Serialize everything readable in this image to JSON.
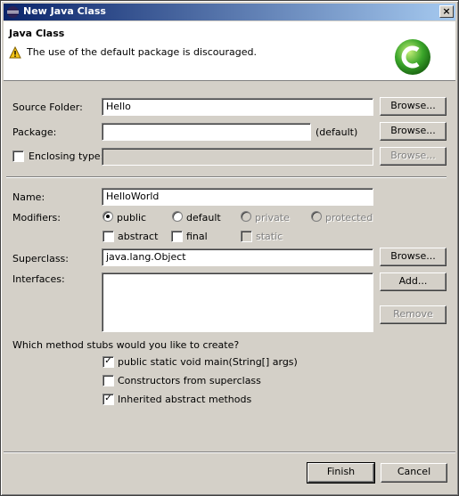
{
  "window": {
    "title": "New Java Class",
    "close_glyph": "×"
  },
  "header": {
    "title": "Java Class",
    "message": "The use of the default package is discouraged.",
    "message_icon": "warning-icon",
    "wizard_icon": "new-class-wizard-icon"
  },
  "form": {
    "source_folder": {
      "label": "Source Folder:",
      "value": "Hello",
      "browse": "Browse..."
    },
    "package": {
      "label": "Package:",
      "value": "",
      "suffix": "(default)",
      "browse": "Browse..."
    },
    "enclosing_type": {
      "label": "Enclosing type:",
      "checked": false,
      "value": "",
      "browse": "Browse..."
    },
    "name": {
      "label": "Name:",
      "value": "HelloWorld"
    },
    "modifiers": {
      "label": "Modifiers:",
      "access": [
        {
          "label": "public",
          "selected": true,
          "enabled": true
        },
        {
          "label": "default",
          "selected": false,
          "enabled": true
        },
        {
          "label": "private",
          "selected": false,
          "enabled": false
        },
        {
          "label": "protected",
          "selected": false,
          "enabled": false
        }
      ],
      "flags": [
        {
          "label": "abstract",
          "checked": false,
          "enabled": true
        },
        {
          "label": "final",
          "checked": false,
          "enabled": true
        },
        {
          "label": "static",
          "checked": false,
          "enabled": false
        }
      ]
    },
    "superclass": {
      "label": "Superclass:",
      "value": "java.lang.Object",
      "browse": "Browse..."
    },
    "interfaces": {
      "label": "Interfaces:",
      "add": "Add...",
      "remove": "Remove"
    },
    "stubs": {
      "question": "Which method stubs would you like to create?",
      "options": [
        {
          "label": "public static void main(String[] args)",
          "checked": true
        },
        {
          "label": "Constructors from superclass",
          "checked": false
        },
        {
          "label": "Inherited abstract methods",
          "checked": true
        }
      ]
    }
  },
  "footer": {
    "finish": "Finish",
    "cancel": "Cancel"
  },
  "check_glyph": "✓"
}
